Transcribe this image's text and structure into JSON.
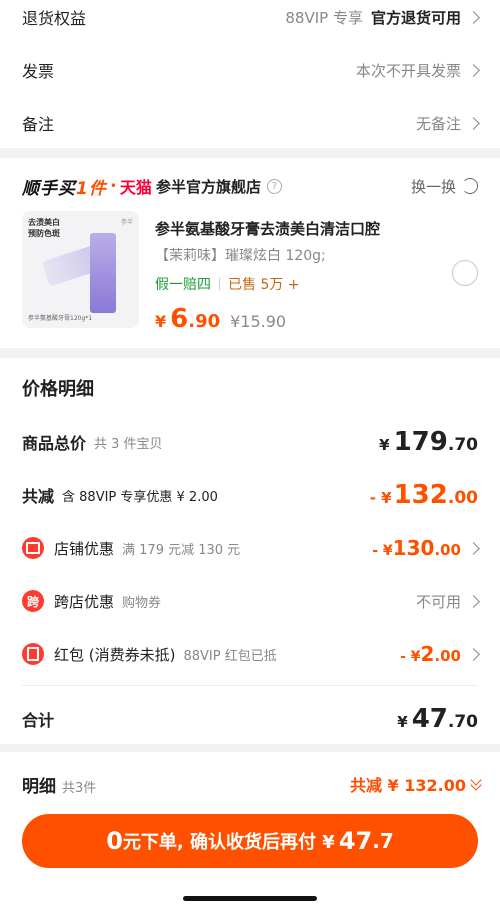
{
  "top_rows": [
    {
      "label": "退货权益",
      "value_gray": "88VIP 专享",
      "value_bold": "官方退货可用"
    },
    {
      "label": "发票",
      "value_gray": "本次不开具发票",
      "value_bold": ""
    },
    {
      "label": "备注",
      "value_gray": "无备注",
      "value_bold": ""
    }
  ],
  "shop": {
    "brand_part1": "顺手买",
    "brand_part2": "1件",
    "tmall": "天猫",
    "name": "参半官方旗舰店",
    "swap_label": "换一换"
  },
  "product": {
    "thumb_text_1": "去渍美白",
    "thumb_text_2": "预防色斑",
    "thumb_bottom": "参半氨基酸牙膏120g*1",
    "thumb_brand": "参半",
    "title": "参半氨基酸牙膏去渍美白清洁口腔",
    "sku": "【茉莉味】璀璨炫白 120g;",
    "tag_green": "假一赔四",
    "tag_sold": "已售 5万 +",
    "price_currency": "¥",
    "price_int": "6",
    "price_dec": ".90",
    "price_orig": "¥15.90"
  },
  "price_detail": {
    "title": "价格明细",
    "total_label": "商品总价",
    "total_sub": "共 3 件宝贝",
    "total_cur": "¥",
    "total_int": "179",
    "total_dec": ".70",
    "reduce_label": "共减",
    "reduce_sub": "含 88VIP 专享优惠 ¥ 2.00",
    "reduce_cur": "- ¥",
    "reduce_int": "132",
    "reduce_dec": ".00",
    "shop_discount_label": "店铺优惠",
    "shop_discount_sub": "满 179 元减 130 元",
    "shop_discount_cur": "- ¥",
    "shop_discount_int": "130",
    "shop_discount_dec": ".00",
    "cross_label": "跨店优惠",
    "cross_icon_text": "跨",
    "cross_sub": "购物券",
    "cross_value": "不可用",
    "redpack_label": "红包 (消费券未抵)",
    "redpack_sub": "88VIP 红包已抵",
    "redpack_cur": "- ¥",
    "redpack_int": "2",
    "redpack_dec": ".00",
    "sum_label": "合计",
    "sum_cur": "¥",
    "sum_int": "47",
    "sum_dec": ".70"
  },
  "bottom": {
    "detail_label": "明细",
    "detail_count": "共3件",
    "detail_reduce": "共减 ¥ 132.00",
    "cta_zero": "0",
    "cta_text": "元下单, 确认收货后再付 ¥",
    "cta_int": "47",
    "cta_dec": ".7"
  }
}
